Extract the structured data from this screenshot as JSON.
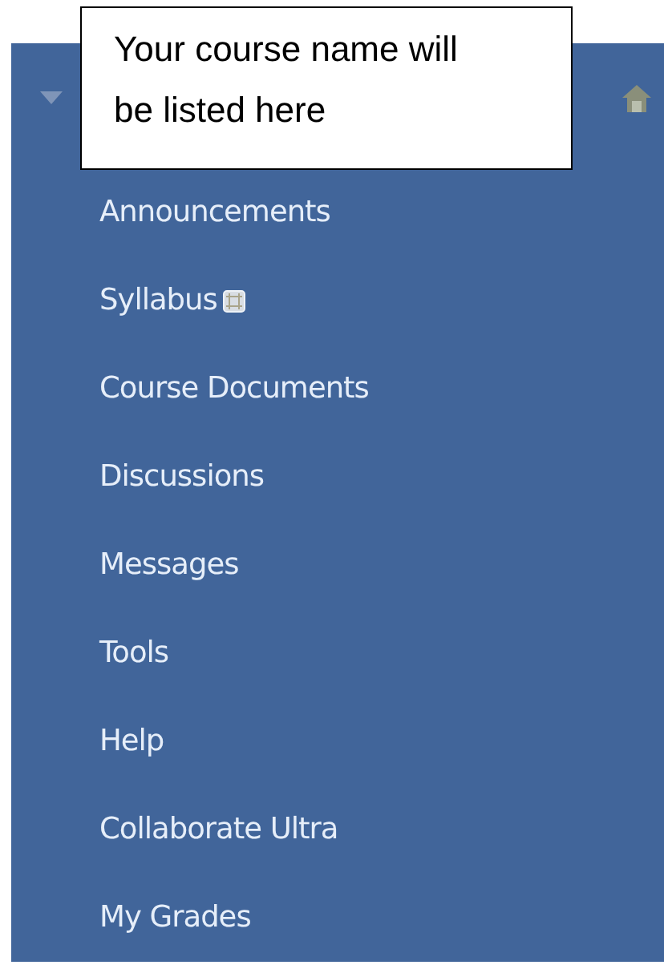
{
  "callout": {
    "text": "Your course name will be listed here"
  },
  "menu": {
    "items": [
      {
        "label": "Announcements",
        "kind": "link"
      },
      {
        "label": "Syllabus",
        "kind": "link_with_icon"
      },
      {
        "label": "Course Documents",
        "kind": "link"
      },
      {
        "label": "Discussions",
        "kind": "link"
      },
      {
        "label": "Messages",
        "kind": "link"
      },
      {
        "label": "Tools",
        "kind": "link"
      },
      {
        "label": "Help",
        "kind": "link"
      },
      {
        "label": "Collaborate Ultra",
        "kind": "link"
      },
      {
        "label": "My Grades",
        "kind": "link"
      }
    ]
  }
}
